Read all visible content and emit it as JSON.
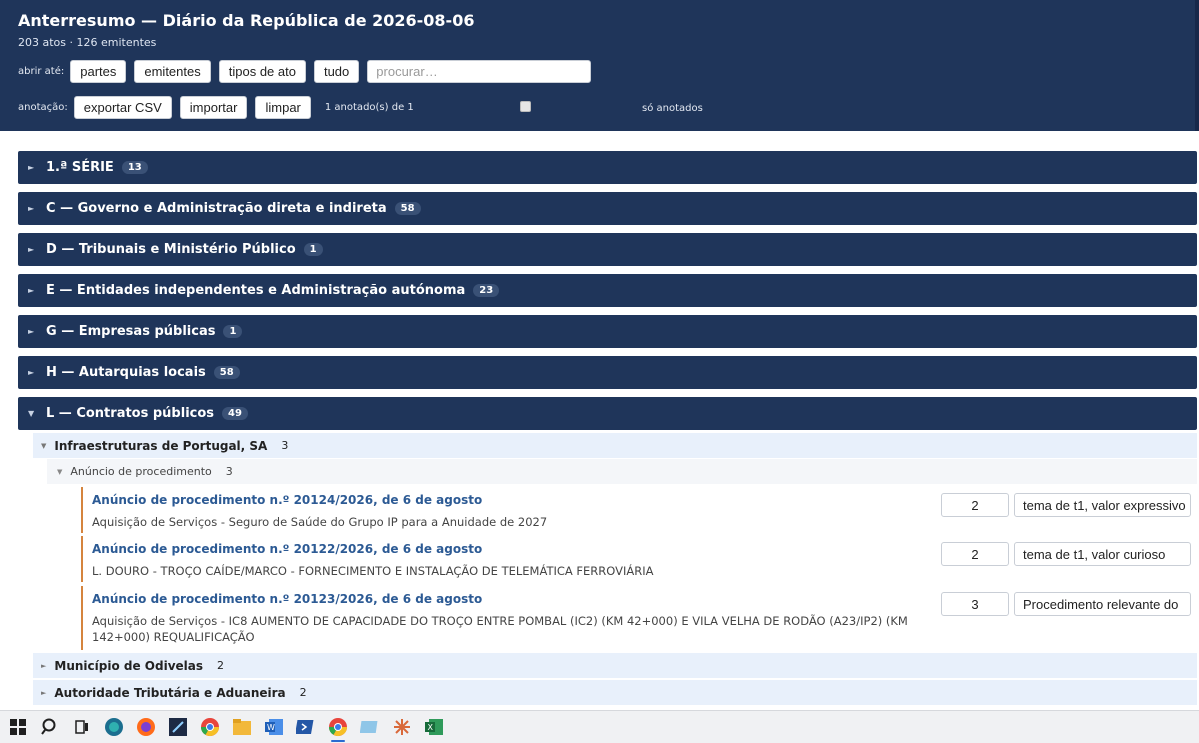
{
  "header": {
    "title": "Anterresumo — Diário da República de 2026-08-06",
    "subtitle": "203 atos · 126 emitentes",
    "open_label": "abrir até:",
    "open_buttons": [
      "partes",
      "emitentes",
      "tipos de ato",
      "tudo"
    ],
    "search_placeholder": "procurar…",
    "annotation_label": "anotação:",
    "annotation_buttons": [
      "exportar CSV",
      "importar",
      "limpar"
    ],
    "annotated_count": "1 anotado(s) de 1",
    "only_annotated_label": "só anotados"
  },
  "sections": [
    {
      "title": "1.ª SÉRIE",
      "count": "13",
      "expanded": false
    },
    {
      "title": "C — Governo e Administração direta e indireta",
      "count": "58",
      "expanded": false
    },
    {
      "title": "D — Tribunais e Ministério Público",
      "count": "1",
      "expanded": false
    },
    {
      "title": "E — Entidades independentes e Administração autónoma",
      "count": "23",
      "expanded": false
    },
    {
      "title": "G — Empresas públicas",
      "count": "1",
      "expanded": false
    },
    {
      "title": "H — Autarquias locais",
      "count": "58",
      "expanded": false
    },
    {
      "title": "L — Contratos públicos",
      "count": "49",
      "expanded": true
    }
  ],
  "contracts": {
    "orgs": [
      {
        "name": "Infraestruturas de Portugal, SA",
        "count": "3",
        "expanded": true
      },
      {
        "name": "Município de Odivelas",
        "count": "2",
        "expanded": false
      },
      {
        "name": "Autoridade Tributária e Aduaneira",
        "count": "2",
        "expanded": false
      }
    ],
    "act_type": {
      "name": "Anúncio de procedimento",
      "count": "3"
    },
    "items": [
      {
        "title": "Anúncio de procedimento n.º 20124/2026, de 6 de agosto",
        "description": "Aquisição de Serviços - Seguro de Saúde do Grupo IP para a Anuidade de 2027",
        "score": "2",
        "note": "tema de t1, valor expressivo"
      },
      {
        "title": "Anúncio de procedimento n.º 20122/2026, de 6 de agosto",
        "description": "L. DOURO - TROÇO CAÍDE/MARCO - FORNECIMENTO E INSTALAÇÃO DE TELEMÁTICA FERROVIÁRIA",
        "score": "2",
        "note": "tema de t1, valor curioso"
      },
      {
        "title": "Anúncio de procedimento n.º 20123/2026, de 6 de agosto",
        "description": "Aquisição de Serviços - IC8 AUMENTO DE CAPACIDADE DO TROÇO ENTRE POMBAL (IC2) (KM 42+000) E VILA VELHA DE RODÃO (A23/IP2) (KM 142+000) REQUALIFICAÇÃO",
        "score": "3",
        "note": "Procedimento relevante do"
      }
    ]
  },
  "taskbar": {
    "icons": [
      "windows-start-icon",
      "search-icon",
      "task-view-icon",
      "edge-browser-icon",
      "firefox-icon",
      "code-editor-icon",
      "chrome-icon",
      "file-explorer-icon",
      "word-icon",
      "powershell-icon",
      "chrome-active-icon",
      "app-icon",
      "claude-icon",
      "excel-icon"
    ]
  },
  "colors": {
    "header_bg": "#1f355a",
    "section_bg": "#1f355a",
    "badge_bg": "#3a5176",
    "org_row_bg": "#e8f0fb",
    "item_title": "#2c5a94",
    "item_accent": "#d5843e"
  }
}
